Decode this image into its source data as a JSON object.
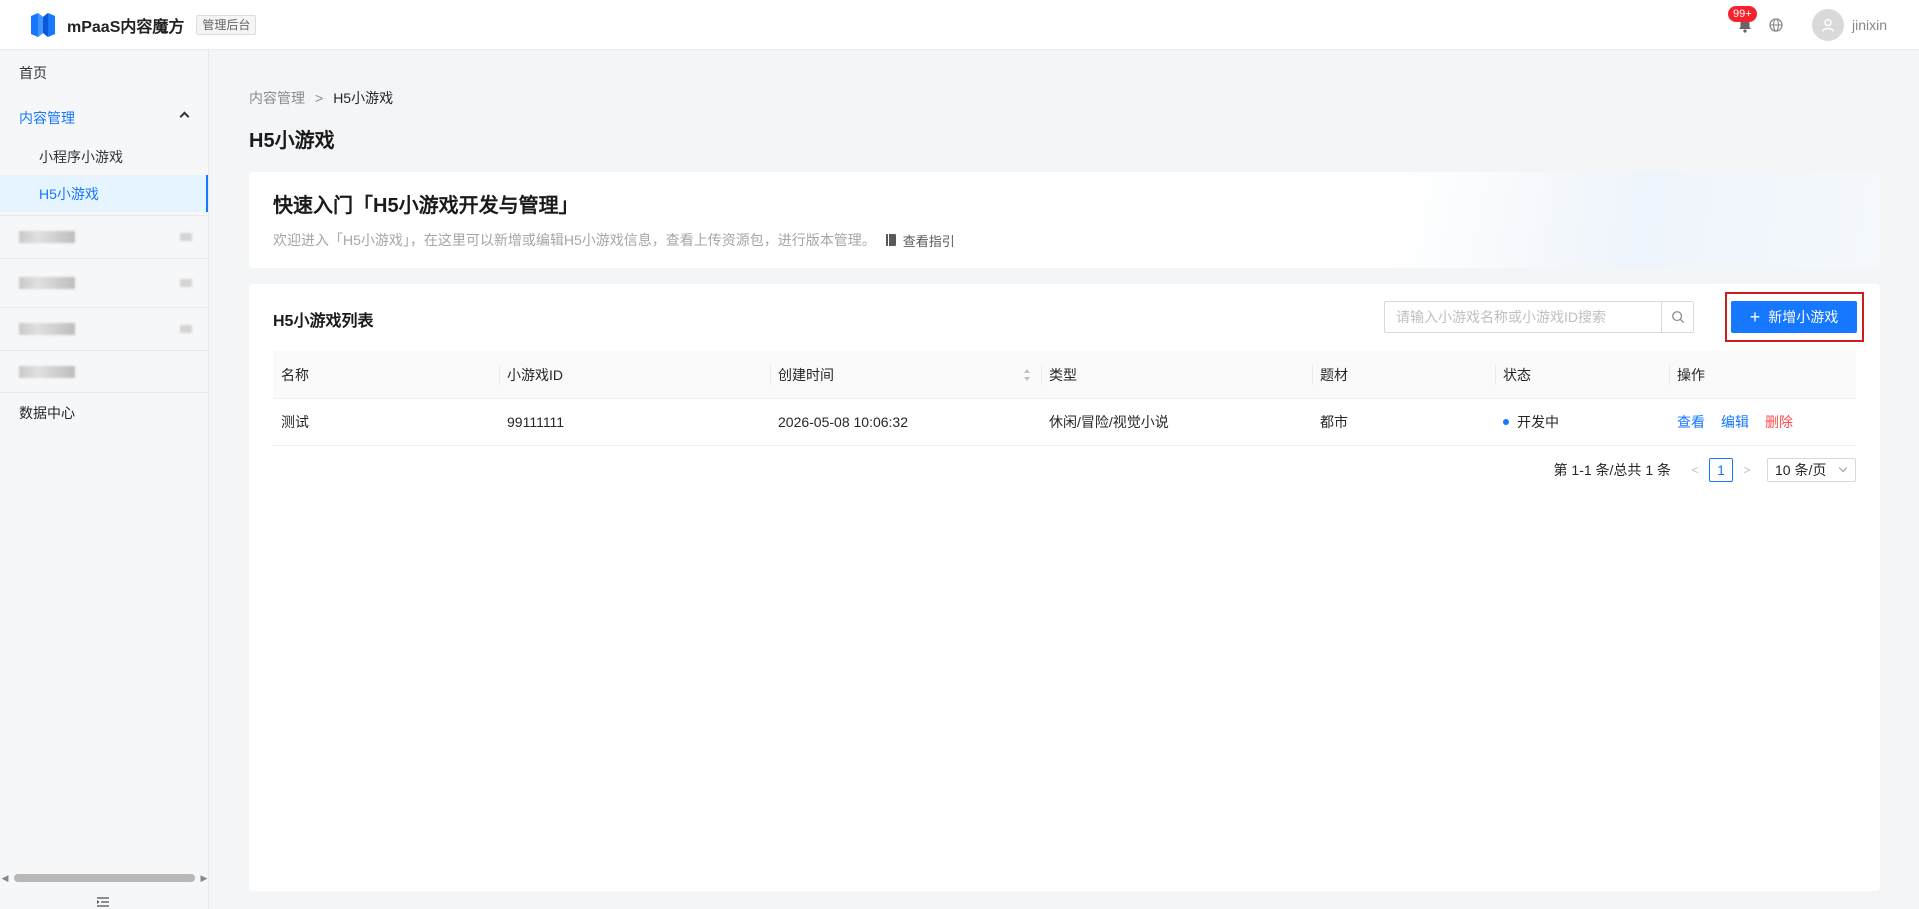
{
  "header": {
    "brand": "mPaaS内容魔方",
    "tag": "管理后台",
    "notification_badge": "99+",
    "username": "jinixin"
  },
  "sidebar": {
    "home": "首页",
    "content_management": "内容管理",
    "mini_program_game": "小程序小游戏",
    "h5_game": "H5小游戏",
    "data_center": "数据中心"
  },
  "breadcrumb": {
    "parent": "内容管理",
    "separator": ">",
    "current": "H5小游戏"
  },
  "page_title": "H5小游戏",
  "intro": {
    "title": "快速入门「H5小游戏开发与管理」",
    "description": "欢迎进入「H5小游戏」，在这里可以新增或编辑H5小游戏信息，查看上传资源包，进行版本管理。",
    "guide_link": "查看指引"
  },
  "list": {
    "title": "H5小游戏列表",
    "search_placeholder": "请输入小游戏名称或小游戏ID搜索",
    "add_button": "新增小游戏",
    "columns": [
      "名称",
      "小游戏ID",
      "创建时间",
      "类型",
      "题材",
      "状态",
      "操作"
    ],
    "rows": [
      {
        "name": "测试",
        "id": "99111111",
        "created": "2026-05-08 10:06:32",
        "type": "休闲/冒险/视觉小说",
        "theme": "都市",
        "status": "开发中",
        "actions": [
          "查看",
          "编辑",
          "删除"
        ]
      }
    ]
  },
  "pagination": {
    "summary": "第 1-1 条/总共 1 条",
    "current_page": "1",
    "page_size": "10 条/页"
  },
  "colors": {
    "primary": "#1677ff",
    "danger": "#ff4d4f",
    "highlight": "#c81e1e"
  }
}
